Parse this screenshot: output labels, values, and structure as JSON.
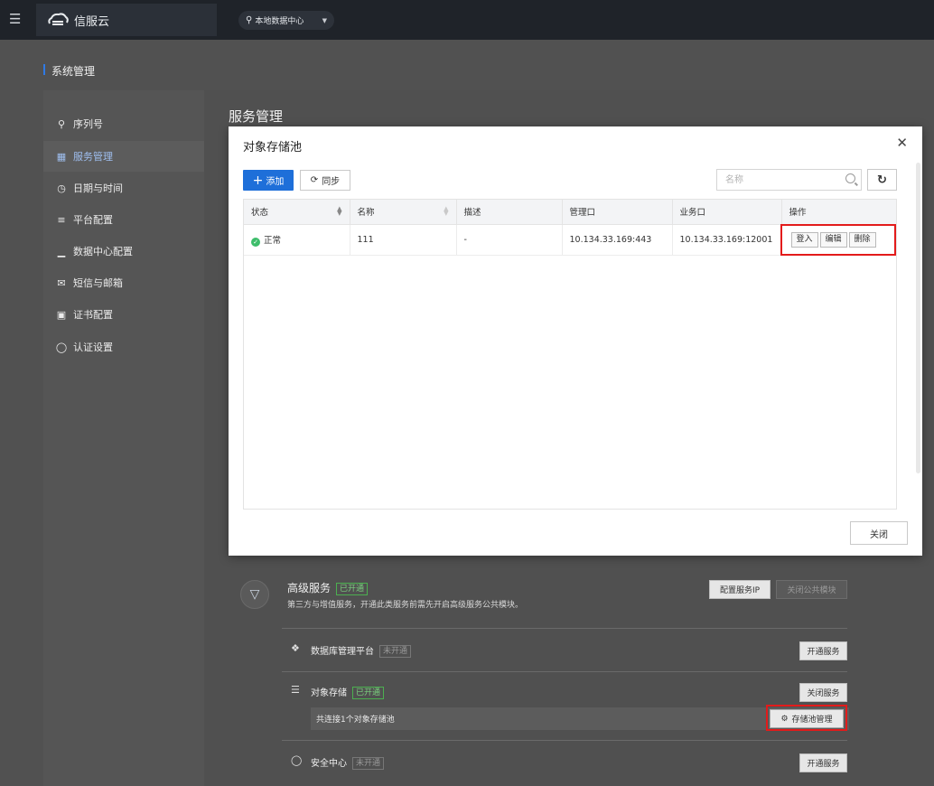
{
  "topbar": {
    "brand_name": "信服云",
    "datacenter": "本地数据中心"
  },
  "page": {
    "section_title": "系统管理",
    "content_title": "服务管理"
  },
  "sidebar": {
    "items": [
      {
        "label": "序列号",
        "icon": "key-icon"
      },
      {
        "label": "服务管理",
        "icon": "grid-icon",
        "active": true
      },
      {
        "label": "日期与时间",
        "icon": "clock-icon"
      },
      {
        "label": "平台配置",
        "icon": "platform-icon"
      },
      {
        "label": "数据中心配置",
        "icon": "bar-chart-icon"
      },
      {
        "label": "短信与邮箱",
        "icon": "mail-icon"
      },
      {
        "label": "证书配置",
        "icon": "certificate-icon"
      },
      {
        "label": "认证设置",
        "icon": "shield-icon"
      }
    ]
  },
  "services": {
    "advanced": {
      "title": "高级服务",
      "badge": "已开通",
      "desc": "第三方与增值服务，开通此类服务前需先开启高级服务公共模块。",
      "btn_config_ip": "配置服务IP",
      "btn_close_public": "关闭公共模块"
    },
    "rows": [
      {
        "name": "数据库管理平台",
        "badge": "未开通",
        "action": "开通服务"
      },
      {
        "name": "对象存储",
        "badge": "已开通",
        "action": "关闭服务"
      },
      {
        "name": "安全中心",
        "badge": "未开通",
        "action": "开通服务"
      }
    ],
    "pool_info": "共连接1个对象存储池",
    "pool_manage_btn": "存储池管理"
  },
  "modal": {
    "title": "对象存储池",
    "add_label": "添加",
    "sync_label": "同步",
    "search_placeholder": "名称",
    "close_label": "关闭",
    "columns": [
      "状态",
      "名称",
      "描述",
      "管理口",
      "业务口",
      "操作"
    ],
    "rows": [
      {
        "status": "正常",
        "name": "111",
        "desc": "-",
        "mgmt": "10.134.33.169:443",
        "service": "10.134.33.169:12001",
        "ops": [
          "登入",
          "编辑",
          "删除"
        ]
      }
    ]
  }
}
